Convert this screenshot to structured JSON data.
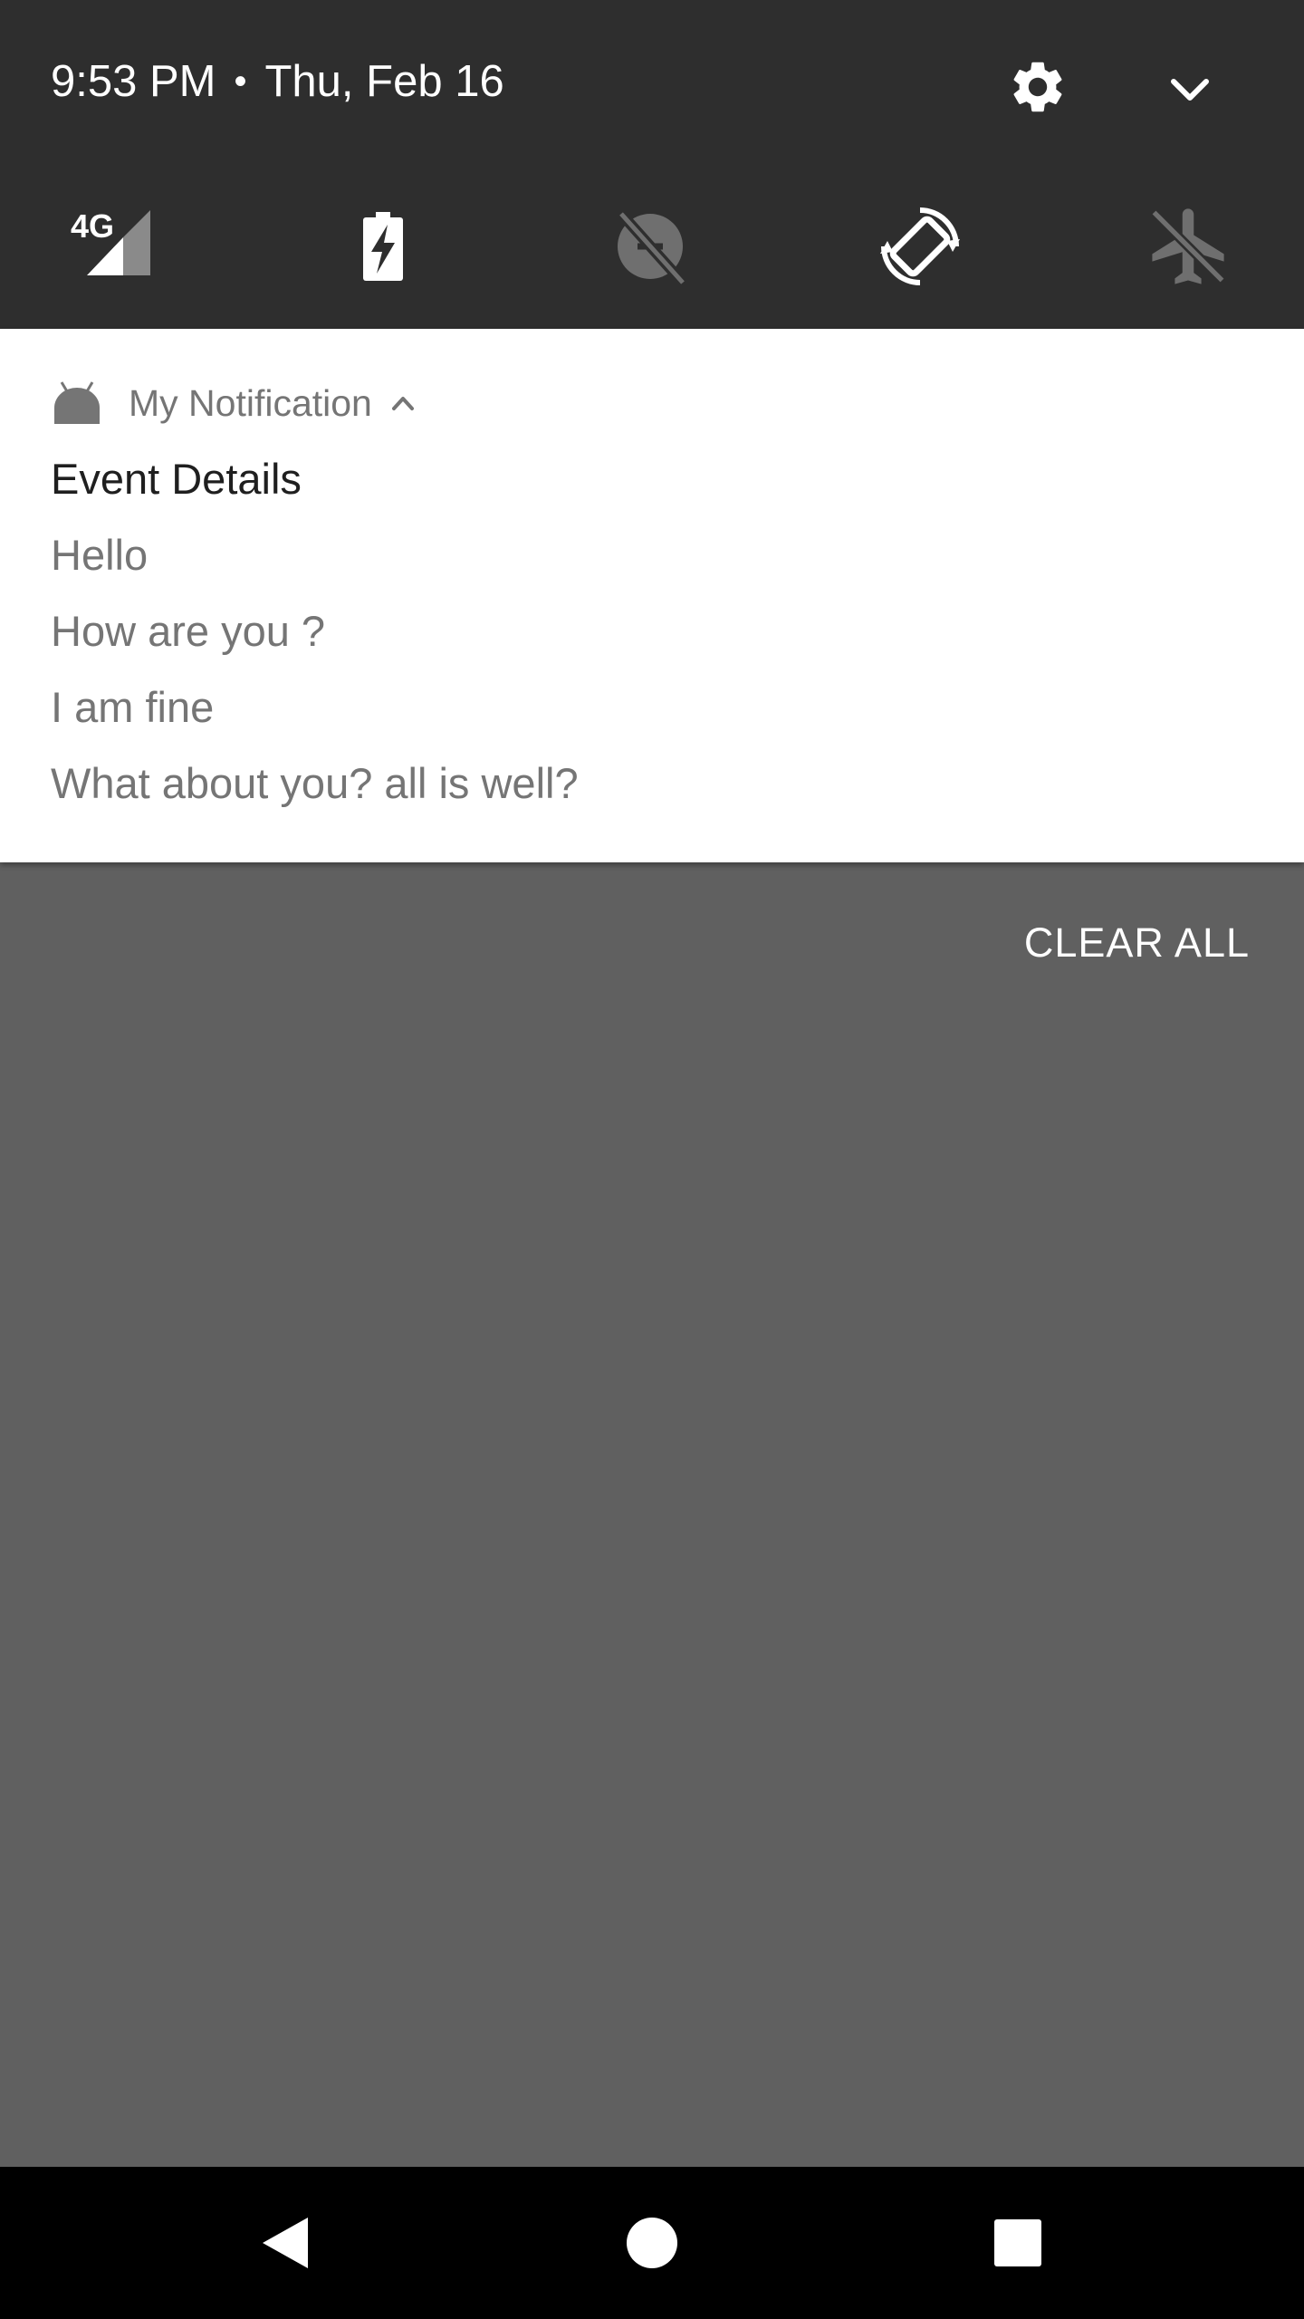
{
  "status": {
    "time": "9:53 PM",
    "separator": "•",
    "date": "Thu, Feb 16"
  },
  "quick_settings": {
    "header_icons": [
      "settings-gear-icon",
      "expand-chevron-icon"
    ],
    "tiles": [
      {
        "name": "cellular-4g",
        "label": "4G",
        "icon": "signal-icon",
        "active": true
      },
      {
        "name": "battery-saver",
        "icon": "battery-charging-icon",
        "active": true
      },
      {
        "name": "data-saver",
        "icon": "data-saver-off-icon",
        "active": false
      },
      {
        "name": "auto-rotate",
        "icon": "rotate-icon",
        "active": true
      },
      {
        "name": "airplane-mode",
        "icon": "airplane-icon",
        "active": false
      }
    ]
  },
  "notification": {
    "app_icon": "android-icon",
    "app_name": "My Notification",
    "title": "Event Details",
    "lines": [
      "Hello",
      "How are you ?",
      "I am fine",
      "What about you? all is well?"
    ]
  },
  "actions": {
    "clear_all": "CLEAR ALL"
  },
  "nav_bar": {
    "buttons": [
      "back-icon",
      "home-icon",
      "recents-icon"
    ]
  },
  "colors": {
    "qs_background": "#2e2e2e",
    "shade_scrim": "#606060",
    "card_background": "#ffffff",
    "secondary_text": "#757575",
    "primary_text": "#1f1f1f",
    "inactive_icon": "#6f6f6f",
    "nav_background": "#000000"
  }
}
